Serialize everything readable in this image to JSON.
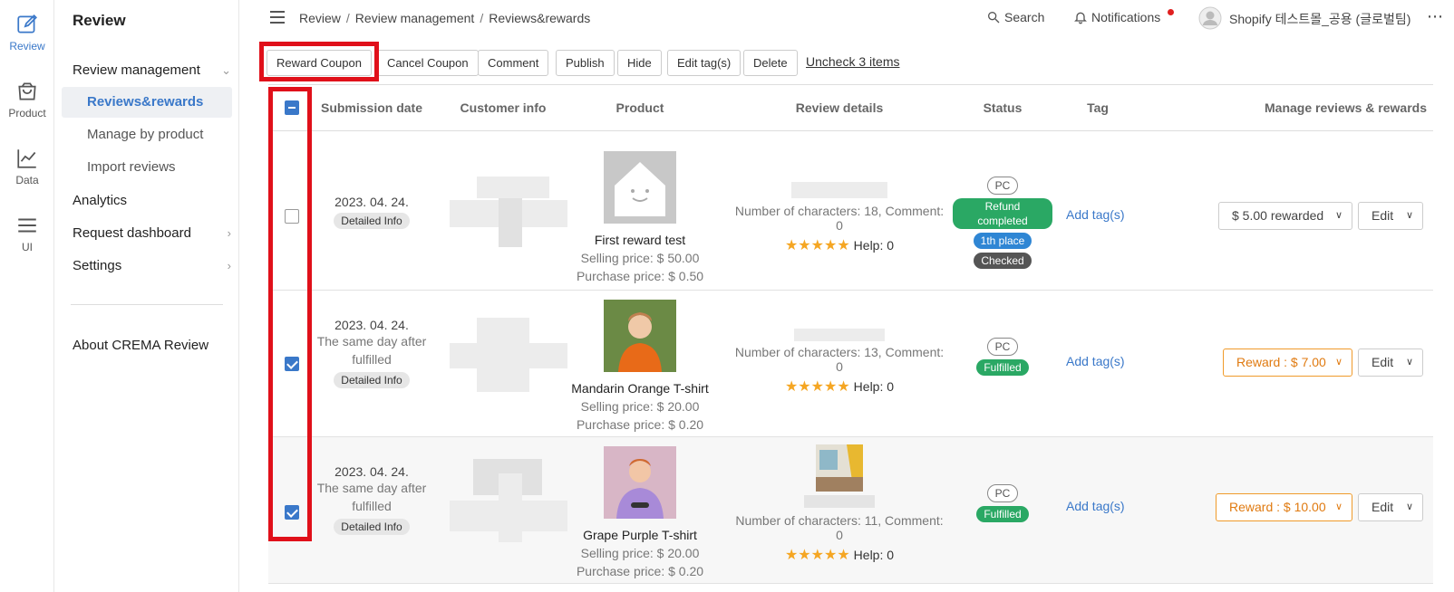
{
  "rail": {
    "items": [
      {
        "label": "Review",
        "icon": "edit-icon"
      },
      {
        "label": "Product",
        "icon": "bag-icon"
      },
      {
        "label": "Data",
        "icon": "line-chart-icon"
      },
      {
        "label": "UI",
        "icon": "menu-icon"
      }
    ]
  },
  "sidebar": {
    "title": "Review",
    "review_management": "Review management",
    "sub_items": [
      "Reviews&rewards",
      "Manage by product",
      "Import reviews"
    ],
    "analytics": "Analytics",
    "request_dashboard": "Request dashboard",
    "settings": "Settings",
    "about": "About CREMA Review"
  },
  "topbar": {
    "breadcrumb": [
      "Review",
      "Review management",
      "Reviews&rewards"
    ],
    "search": "Search",
    "notifications": "Notifications",
    "store_name": "Shopify 테스트몰_공용 (글로벌팀)"
  },
  "toolbar": {
    "reward_coupon": "Reward Coupon",
    "cancel_coupon": "Cancel Coupon",
    "comment": "Comment",
    "publish": "Publish",
    "hide": "Hide",
    "edit_tags": "Edit tag(s)",
    "delete": "Delete",
    "uncheck": "Uncheck 3 items"
  },
  "table": {
    "headers": [
      "Submission date",
      "Customer info",
      "Product",
      "Review details",
      "Status",
      "Tag",
      "Manage reviews & rewards"
    ],
    "rows": [
      {
        "checked": false,
        "date": "2023. 04. 24.",
        "date_note": "",
        "detail_btn": "Detailed Info",
        "product_name": "First reward test",
        "selling_price": "Selling price: $ 50.00",
        "purchase_price": "Purchase price: $ 0.50",
        "review_meta": "Number of characters: 18, Comment: 0",
        "stars": "★★★★★",
        "help": "Help: 0",
        "badges": [
          "PC",
          "Refund completed",
          "1th place",
          "Checked"
        ],
        "tag": "Add tag(s)",
        "reward": "$ 5.00 rewarded",
        "edit": "Edit"
      },
      {
        "checked": true,
        "date": "2023. 04. 24.",
        "date_note": "The same day after fulfilled",
        "detail_btn": "Detailed Info",
        "product_name": "Mandarin Orange T-shirt",
        "selling_price": "Selling price: $ 20.00",
        "purchase_price": "Purchase price: $ 0.20",
        "review_meta": "Number of characters: 13, Comment: 0",
        "stars": "★★★★★",
        "help": "Help: 0",
        "badges": [
          "PC",
          "Fulfilled"
        ],
        "tag": "Add tag(s)",
        "reward": "Reward : $ 7.00",
        "edit": "Edit"
      },
      {
        "checked": true,
        "date": "2023. 04. 24.",
        "date_note": "The same day after fulfilled",
        "detail_btn": "Detailed Info",
        "product_name": "Grape Purple T-shirt",
        "selling_price": "Selling price: $ 20.00",
        "purchase_price": "Purchase price: $ 0.20",
        "review_meta": "Number of characters: 11, Comment: 0",
        "stars": "★★★★★",
        "help": "Help: 0",
        "badges": [
          "PC",
          "Fulfilled"
        ],
        "tag": "Add tag(s)",
        "reward": "Reward : $ 10.00",
        "edit": "Edit"
      }
    ]
  },
  "colors": {
    "accent": "#3a78c9",
    "highlight": "#e0101a",
    "reward_orange": "#f09a2a",
    "star": "#f5a623",
    "badge_green": "#2aa864",
    "badge_blue": "#2f86d4"
  }
}
